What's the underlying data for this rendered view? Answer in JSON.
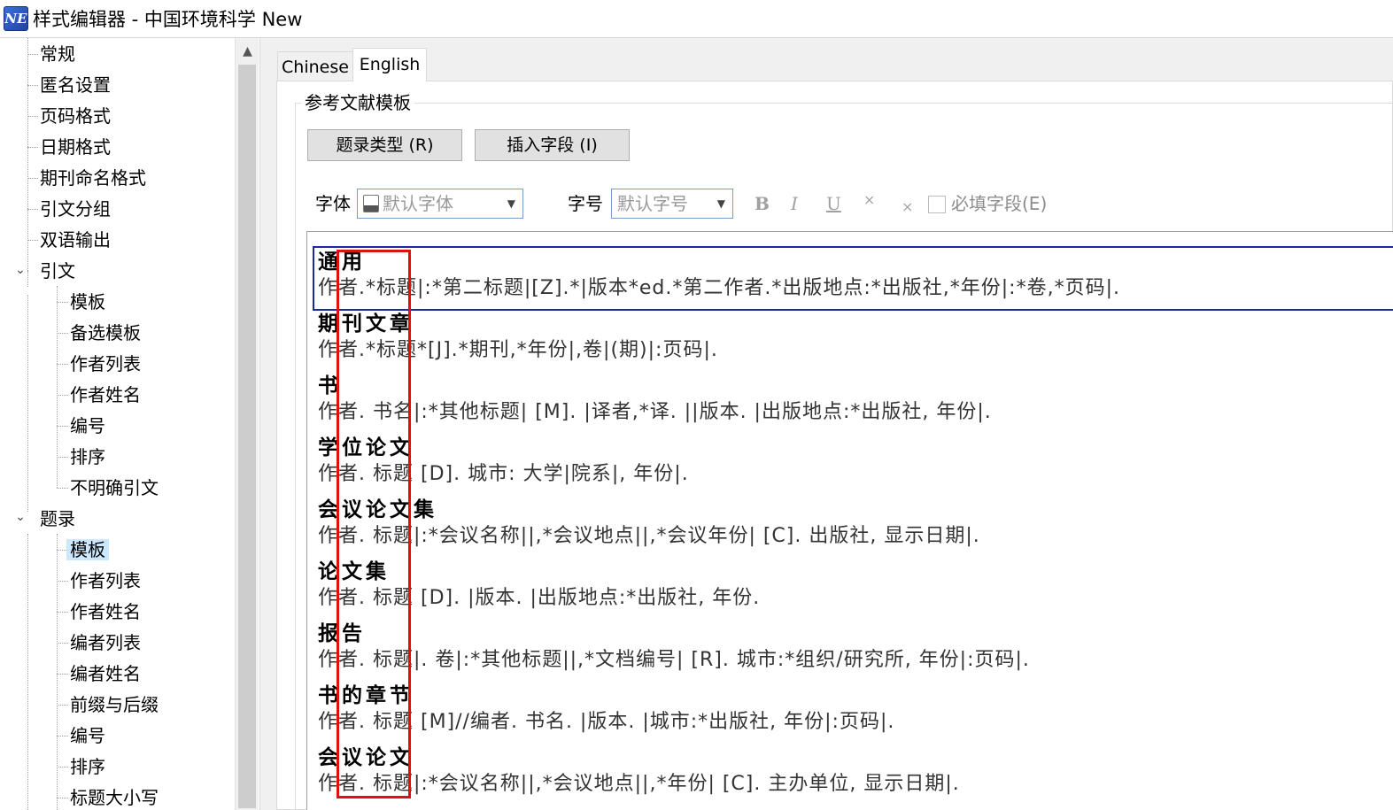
{
  "window": {
    "title": "样式编辑器 - 中国环境科学 New",
    "icon": "NE"
  },
  "tree": {
    "items": [
      {
        "label": "常规",
        "level": 0
      },
      {
        "label": "匿名设置",
        "level": 0
      },
      {
        "label": "页码格式",
        "level": 0
      },
      {
        "label": "日期格式",
        "level": 0
      },
      {
        "label": "期刊命名格式",
        "level": 0
      },
      {
        "label": "引文分组",
        "level": 0
      },
      {
        "label": "双语输出",
        "level": 0
      },
      {
        "label": "引文",
        "level": 0,
        "expanded": true
      },
      {
        "label": "模板",
        "level": 1
      },
      {
        "label": "备选模板",
        "level": 1
      },
      {
        "label": "作者列表",
        "level": 1
      },
      {
        "label": "作者姓名",
        "level": 1
      },
      {
        "label": "编号",
        "level": 1
      },
      {
        "label": "排序",
        "level": 1
      },
      {
        "label": "不明确引文",
        "level": 1
      },
      {
        "label": "题录",
        "level": 0,
        "expanded": true
      },
      {
        "label": "模板",
        "level": 1,
        "selected": true
      },
      {
        "label": "作者列表",
        "level": 1
      },
      {
        "label": "作者姓名",
        "level": 1
      },
      {
        "label": "编者列表",
        "level": 1
      },
      {
        "label": "编者姓名",
        "level": 1
      },
      {
        "label": "前缀与后缀",
        "level": 1
      },
      {
        "label": "编号",
        "level": 1
      },
      {
        "label": "排序",
        "level": 1
      },
      {
        "label": "标题大小写",
        "level": 1
      }
    ]
  },
  "tabs": [
    {
      "label": "Chinese",
      "active": false
    },
    {
      "label": "English",
      "active": true
    }
  ],
  "group": {
    "title": "参考文献模板",
    "ref_type_button": "题录类型 (R)",
    "insert_field_button": "插入字段 (I)",
    "font_label": "字体",
    "font_value": "默认字体",
    "size_label": "字号",
    "size_value": "默认字号",
    "bold": "B",
    "italic": "I",
    "underline": "U",
    "superscript": "×",
    "subscript": "×",
    "required_label": "必填字段(E)"
  },
  "templates": [
    {
      "name": "通用",
      "line": "作者.*标题|:*第二标题|[Z].*|版本*ed.*第二作者.*出版地点:*出版社,*年份|:*卷,*页码|."
    },
    {
      "name": "期刊文章",
      "line": "作者.*标题*[J].*期刊,*年份|,卷|(期)|:页码|."
    },
    {
      "name": "书",
      "line": "作者. 书名|:*其他标题| [M]. |译者,*译. ||版本. |出版地点:*出版社, 年份|."
    },
    {
      "name": "学位论文",
      "line": "作者. 标题 [D]. 城市: 大学|院系|, 年份|."
    },
    {
      "name": "会议论文集",
      "line": "作者. 标题|:*会议名称||,*会议地点||,*会议年份| [C]. 出版社, 显示日期|."
    },
    {
      "name": "论文集",
      "line": "作者. 标题 [D]. |版本. |出版地点:*出版社, 年份."
    },
    {
      "name": "报告",
      "line": "作者. 标题|. 卷|:*其他标题||,*文档编号| [R]. 城市:*组织/研究所, 年份|:页码|."
    },
    {
      "name": "书的章节",
      "line": "作者. 标题 [M]//编者. 书名. |版本. |城市:*出版社, 年份|:页码|."
    },
    {
      "name": "会议论文",
      "line": "作者. 标题|:*会议名称||,*会议地点||,*年份| [C]. 主办单位, 显示日期|."
    }
  ],
  "colors": {
    "selection_border": "#1a2a9c",
    "highlight_box": "#e01010",
    "tree_selected": "#cce8ff"
  }
}
